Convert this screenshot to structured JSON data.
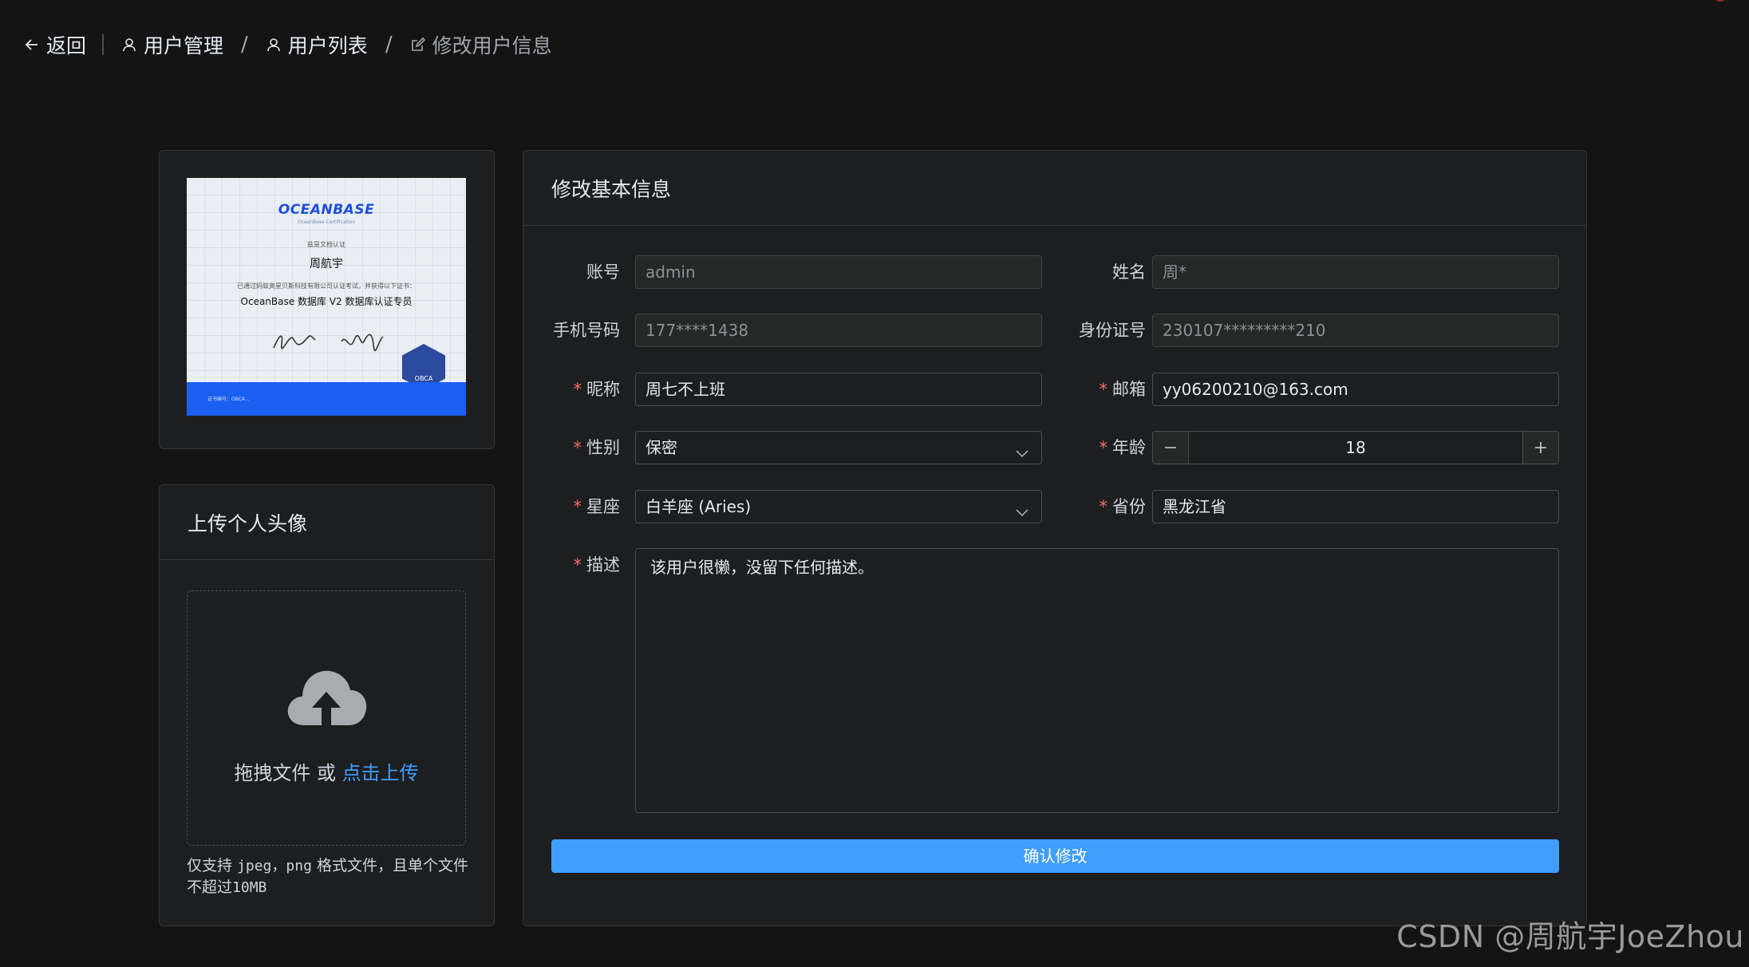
{
  "breadcrumb": {
    "back_label": "返回",
    "items": [
      "用户管理",
      "用户列表",
      "修改用户信息"
    ]
  },
  "certificate": {
    "logo": "OCEANBASE",
    "logo_sub": "OceanBase Certification",
    "line1": "兹是文档认证",
    "name": "周航宇",
    "line2": "已通过蚂蚁奥星贝斯科技有限公司认证考试，并获得以下证书：",
    "line3": "OceanBase 数据库 V2 数据库认证专员",
    "badge": "OBCA",
    "footer": "证书编号：OBCA..."
  },
  "upload": {
    "title": "上传个人头像",
    "drag_text": "拖拽文件 或 ",
    "click_text": "点击上传",
    "tip_pre": "仅支持 ",
    "tip_formats": "jpeg，png",
    "tip_mid": " 格式文件，且单个文件不超过",
    "tip_size": "10MB"
  },
  "form": {
    "title": "修改基本信息",
    "account": {
      "label": "账号",
      "value": "admin"
    },
    "realname": {
      "label": "姓名",
      "value": "周*"
    },
    "phone": {
      "label": "手机号码",
      "value": "177****1438"
    },
    "idcard": {
      "label": "身份证号",
      "value": "230107*********210"
    },
    "nickname": {
      "label": "昵称",
      "value": "周七不上班"
    },
    "email": {
      "label": "邮箱",
      "value": "yy06200210@163.com"
    },
    "gender": {
      "label": "性别",
      "value": "保密"
    },
    "age": {
      "label": "年龄",
      "value": "18"
    },
    "zodiac": {
      "label": "星座",
      "value": "白羊座 (Aries)"
    },
    "province": {
      "label": "省份",
      "value": "黑龙江省"
    },
    "desc": {
      "label": "描述",
      "value": "该用户很懒，没留下任何描述。"
    },
    "required_mark": "*",
    "submit": "确认修改"
  },
  "watermark": "CSDN @周航宇JoeZhou",
  "colors": {
    "accent": "#409eff",
    "required": "#f56c6c",
    "background": "#141414",
    "card": "#1d1e1f"
  },
  "icons": [
    "arrow-left-icon",
    "user-icon",
    "edit-icon",
    "cloud-upload-icon",
    "chevron-down-icon",
    "minus-icon",
    "plus-icon"
  ]
}
